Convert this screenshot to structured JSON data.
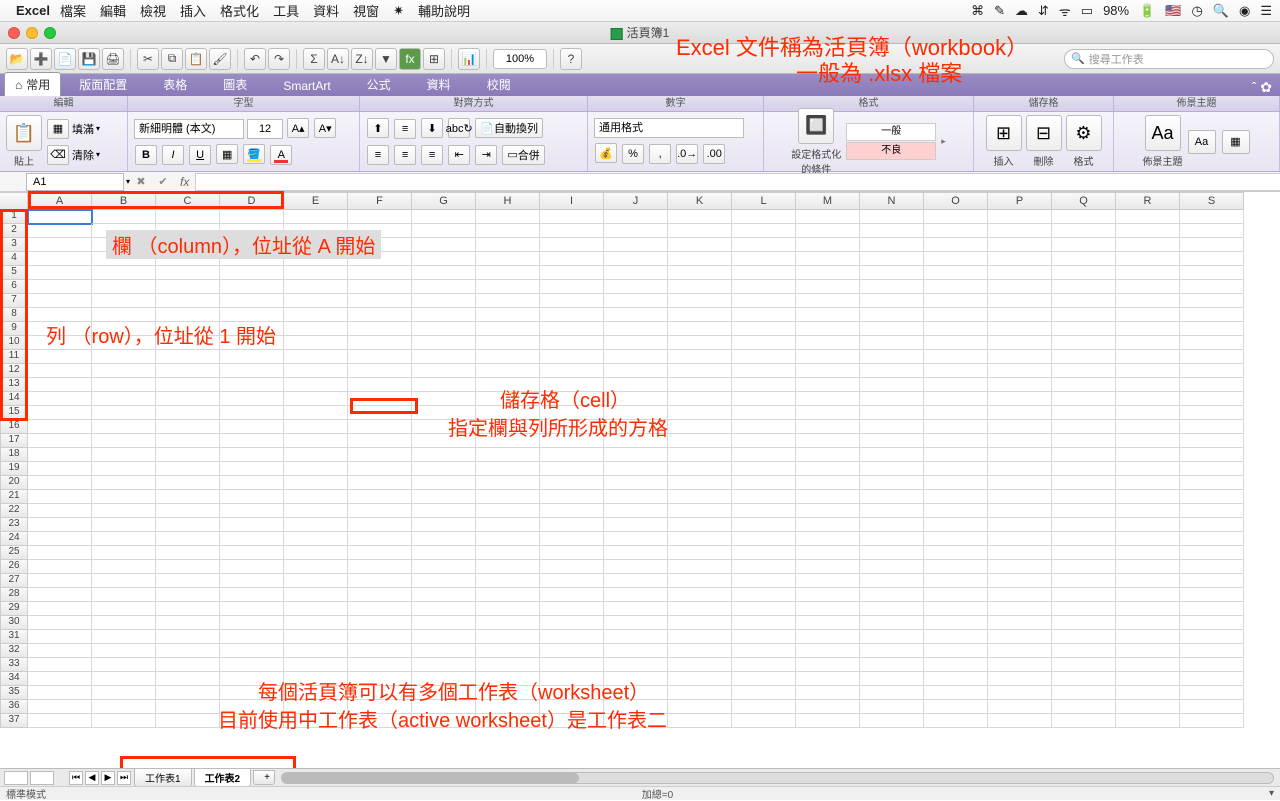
{
  "menubar": {
    "app": "Excel",
    "items": [
      "檔案",
      "編輯",
      "檢視",
      "插入",
      "格式化",
      "工具",
      "資料",
      "視窗"
    ],
    "help": "輔助說明",
    "battery": "98%"
  },
  "titlebar": {
    "doc": "活頁簿1"
  },
  "toolbar": {
    "zoom": "100%",
    "search_placeholder": "搜尋工作表"
  },
  "ribbon": {
    "tabs": {
      "home": "常用",
      "layout": "版面配置",
      "tables": "表格",
      "charts": "圖表",
      "smartart": "SmartArt",
      "formulas": "公式",
      "data": "資料",
      "review": "校閱"
    },
    "groups": {
      "edit": "編輯",
      "font": "字型",
      "align": "對齊方式",
      "number": "數字",
      "format": "格式",
      "cells": "儲存格",
      "themes": "佈景主題"
    },
    "paste": "貼上",
    "fill": "填滿",
    "clear": "清除",
    "font_name": "新細明體 (本文)",
    "font_size": "12",
    "wrap": "自動換列",
    "merge": "合併",
    "number_format": "通用格式",
    "cond_fmt": "設定格式化的條件",
    "style_normal": "一般",
    "style_bad": "不良",
    "insert": "插入",
    "delete": "刪除",
    "fmt": "格式",
    "themes_btn": "佈景主題",
    "aa": "Aa"
  },
  "namebox": "A1",
  "columns": [
    "A",
    "B",
    "C",
    "D",
    "E",
    "F",
    "G",
    "H",
    "I",
    "J",
    "K",
    "L",
    "M",
    "N",
    "O",
    "P",
    "Q",
    "R",
    "S"
  ],
  "row_count": 37,
  "annotations": {
    "workbook1": "Excel 文件稱為活頁簿（workbook）",
    "workbook2": "一般為 .xlsx 檔案",
    "column": "欄 （column），位址從 A 開始",
    "row": "列 （row），位址從 1 開始",
    "cell1": "儲存格（cell）",
    "cell2": "指定欄與列所形成的方格",
    "ws1": "每個活頁簿可以有多個工作表（worksheet）",
    "ws2": "目前使用中工作表（active worksheet）是工作表二"
  },
  "sheets": {
    "s1": "工作表1",
    "s2": "工作表2",
    "add": "+"
  },
  "status": {
    "mode": "標準模式",
    "sum": "加總=0"
  }
}
